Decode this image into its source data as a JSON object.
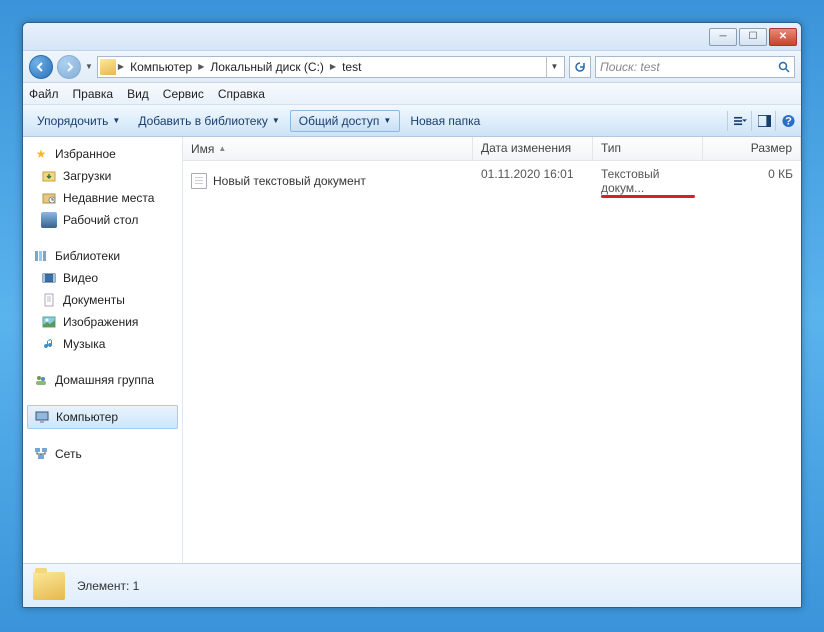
{
  "breadcrumb": {
    "items": [
      "Компьютер",
      "Локальный диск (C:)",
      "test"
    ]
  },
  "search": {
    "placeholder": "Поиск: test"
  },
  "menu": {
    "file": "Файл",
    "edit": "Правка",
    "view": "Вид",
    "tools": "Сервис",
    "help": "Справка"
  },
  "toolbar": {
    "organize": "Упорядочить",
    "addlib": "Добавить в библиотеку",
    "share": "Общий доступ",
    "newfolder": "Новая папка"
  },
  "sidebar": {
    "favorites": "Избранное",
    "downloads": "Загрузки",
    "recent": "Недавние места",
    "desktop": "Рабочий стол",
    "libraries": "Библиотеки",
    "videos": "Видео",
    "documents": "Документы",
    "pictures": "Изображения",
    "music": "Музыка",
    "homegroup": "Домашняя группа",
    "computer": "Компьютер",
    "network": "Сеть"
  },
  "columns": {
    "name": "Имя",
    "date": "Дата изменения",
    "type": "Тип",
    "size": "Размер"
  },
  "file": {
    "name": "Новый текстовый документ",
    "date": "01.11.2020 16:01",
    "type": "Текстовый докум...",
    "size": "0 КБ"
  },
  "status": {
    "label": "Элемент: 1"
  }
}
